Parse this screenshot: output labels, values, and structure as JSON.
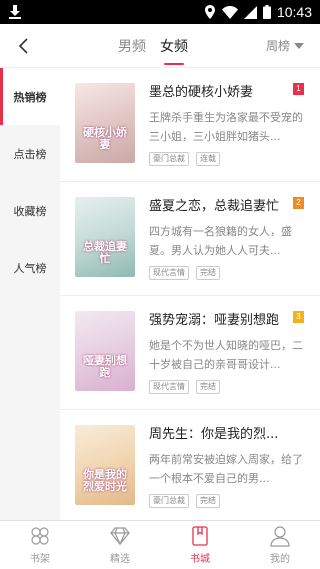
{
  "status_bar": {
    "time": "10:43"
  },
  "header": {
    "tabs": [
      {
        "label": "男频",
        "active": false
      },
      {
        "label": "女频",
        "active": true
      }
    ],
    "period_selector": "周榜"
  },
  "sidebar": {
    "items": [
      {
        "label": "热销榜",
        "active": true
      },
      {
        "label": "点击榜",
        "active": false
      },
      {
        "label": "收藏榜",
        "active": false
      },
      {
        "label": "人气榜",
        "active": false
      }
    ]
  },
  "books": [
    {
      "title": "墨总的硬核小娇妻",
      "rank": "1",
      "rank_color": "#e8304d",
      "description": "王牌杀手重生为洛家最不受宠的三小姐，三小姐胖如猪头...",
      "tags": [
        "豪门总裁",
        "连载"
      ],
      "cover_text": "硬核小娇妻",
      "cover_colors": [
        "#f6e7e6",
        "#e2c7c4",
        "#c9a9a7"
      ]
    },
    {
      "title": "盛夏之恋，总裁追妻忙",
      "rank": "2",
      "rank_color": "#f08a24",
      "description": "四方城有一名狼籍的女人，盛夏。男人认为她人人可夫...",
      "tags": [
        "现代言情",
        "完结"
      ],
      "cover_text": "总裁追妻忙",
      "cover_colors": [
        "#e6f0ee",
        "#c4dbd6",
        "#8fb9b1"
      ]
    },
    {
      "title": "强势宠溺：哑妻别想跑",
      "rank": "3",
      "rank_color": "#f2b21b",
      "description": "她是个不为世人知晓的哑巴，二十岁被自己的亲哥哥设计...",
      "tags": [
        "现代言情",
        "完结"
      ],
      "cover_text": "哑妻别想跑",
      "cover_colors": [
        "#f3e9f0",
        "#e6cfe0",
        "#d9b0cf"
      ]
    },
    {
      "title": "周先生：你是我的烈...",
      "rank": "",
      "rank_color": "",
      "description": "两年前常安被迫嫁入周家，给了一个根本不爱自己的男...",
      "tags": [
        "豪门总裁",
        "完结"
      ],
      "cover_text": "你是我的烈爱时光",
      "cover_colors": [
        "#f9ecd9",
        "#f1d6b2",
        "#e4b98a"
      ]
    }
  ],
  "bottom_nav": [
    {
      "label": "书架",
      "icon": "shelf-icon",
      "active": false
    },
    {
      "label": "精选",
      "icon": "diamond-icon",
      "active": false
    },
    {
      "label": "书城",
      "icon": "book-icon",
      "active": true
    },
    {
      "label": "我的",
      "icon": "user-icon",
      "active": false
    }
  ]
}
